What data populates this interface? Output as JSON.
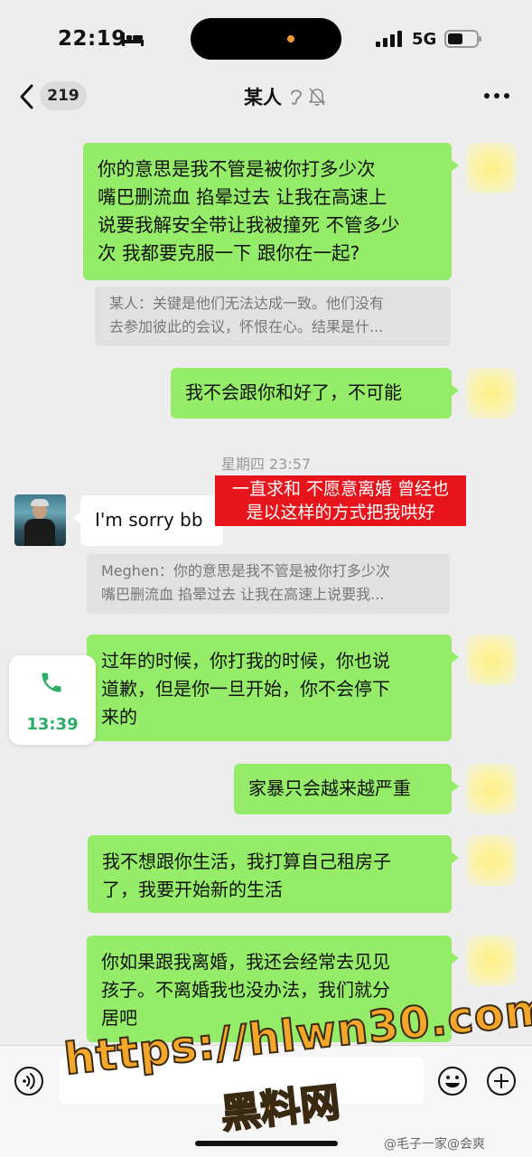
{
  "status_bar": {
    "time": "22:19",
    "network": "5G"
  },
  "nav": {
    "unread_count": "219",
    "title": "某人"
  },
  "messages": [
    {
      "text": "你的意思是我不管是被你打多少次\n嘴巴删流血 掐晕过去 让我在高速上\n说要我解安全带让我被撞死 不管多少\n次 我都要克服一下 跟你在一起?"
    },
    {
      "quote_line1": "某人：关键是他们无法达成一致。他们没有",
      "quote_line2": "去参加彼此的会议，怀恨在心。结果是什..."
    },
    {
      "text": "我不会跟你和好了，不可能"
    },
    {
      "timestamp": "星期四 23:57"
    },
    {
      "text": "I'm sorry bb"
    },
    {
      "quote_line1": "Meghen：你的意思是我不管是被你打多少次",
      "quote_line2": "嘴巴删流血 掐晕过去 让我在高速上说要我..."
    },
    {
      "text": "过年的时候，你打我的时候，你也说\n道歉，但是你一旦开始，你不会停下\n来的"
    },
    {
      "text": "家暴只会越来越严重"
    },
    {
      "text": "我不想跟你生活，我打算自己租房子\n了，我要开始新的生活"
    },
    {
      "text": "你如果跟我离婚，我还会经常去见见\n孩子。不离婚我也没办法，我们就分\n居吧"
    }
  ],
  "annotation": {
    "line1": "一直求和 不愿意离婚 曾经也",
    "line2": "是以这样的方式把我哄好"
  },
  "call_card": {
    "time": "13:39"
  },
  "watermark": {
    "url": "https://hlwn30.com",
    "cn": "黑料网",
    "credit": "@毛子一家@会爽"
  },
  "colors": {
    "bubble_green": "#95ec69",
    "annotation_red": "#e8141c",
    "call_green": "#2aae67"
  }
}
